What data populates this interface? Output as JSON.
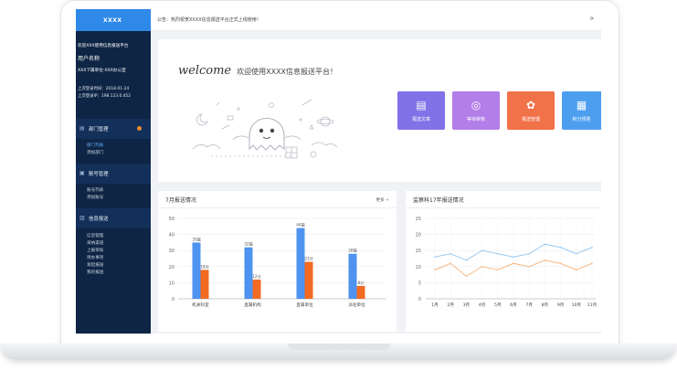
{
  "sidebar": {
    "logo": "XXXX",
    "welcome": "欢迎XXX使用信息报送平台",
    "user_name": "用户名称",
    "unit": "XXX下属单位-XXX办公室",
    "last_login_time": "上次登录时间：2018-01-24",
    "last_login_ip": "上次登录IP：198.123.0.452",
    "groups": [
      {
        "label": "部门管理",
        "icon": "department-icon",
        "items": [
          "部门列表",
          "添加部门"
        ],
        "has_badge": true
      },
      {
        "label": "账号管理",
        "icon": "account-icon",
        "items": [
          "账号列表",
          "添加账号"
        ]
      },
      {
        "label": "信息报送",
        "icon": "report-icon",
        "items": [
          "信息管理",
          "采纳渠道",
          "上报审核",
          "待办事项",
          "发起报送",
          "我的报送"
        ]
      }
    ]
  },
  "notice": {
    "text": "公告：热烈祝贺XXXX信息报送平台正式上线使用！",
    "refresh_icon": "refresh-icon"
  },
  "welcome": {
    "word": "welcome",
    "text": "欢迎使用XXXX信息报送平台！"
  },
  "quick_actions": [
    {
      "label": "报送文章",
      "color": "#8272e8",
      "icon": "article-icon"
    },
    {
      "label": "等待审核",
      "color": "#b27ee8",
      "icon": "audit-icon"
    },
    {
      "label": "报送管理",
      "color": "#f17148",
      "icon": "manage-icon"
    },
    {
      "label": "积分规则",
      "color": "#4e9ef0",
      "icon": "rules-icon"
    }
  ],
  "bar_panel": {
    "title": "7月报送情况",
    "more": "更多 +",
    "chart_data": {
      "type": "bar",
      "categories": [
        "机关科室",
        "直属机构",
        "直属单位",
        "派驻单位"
      ],
      "ylim": [
        0,
        50
      ],
      "yticks": [
        0,
        10,
        20,
        30,
        40,
        50
      ],
      "series": [
        {
          "values": [
            35,
            32,
            44,
            28
          ],
          "color": "#4e93f0",
          "labels": [
            "35篇",
            "32篇",
            "44篇",
            "28篇"
          ]
        },
        {
          "values": [
            18,
            12,
            23,
            8
          ],
          "color": "#f26b22",
          "labels": [
            "18分",
            "12分",
            "23分",
            "8分"
          ]
        }
      ],
      "grid": true
    }
  },
  "line_panel": {
    "title": "监察科17年报送情况",
    "chart_data": {
      "type": "line",
      "categories": [
        "1月",
        "2月",
        "3月",
        "4月",
        "5月",
        "6月",
        "7月",
        "8月",
        "9月",
        "10月",
        "11月"
      ],
      "ylim": [
        0,
        25
      ],
      "yticks": [
        0,
        5,
        10,
        15,
        20,
        25
      ],
      "series": [
        {
          "values": [
            13,
            14,
            12,
            15,
            14,
            13,
            14,
            17,
            16,
            14,
            16
          ],
          "color": "#8fc6f2"
        },
        {
          "values": [
            9,
            11,
            7,
            10,
            9,
            11,
            10,
            12,
            11,
            9,
            11
          ],
          "color": "#f5b177"
        }
      ],
      "grid": true
    }
  }
}
